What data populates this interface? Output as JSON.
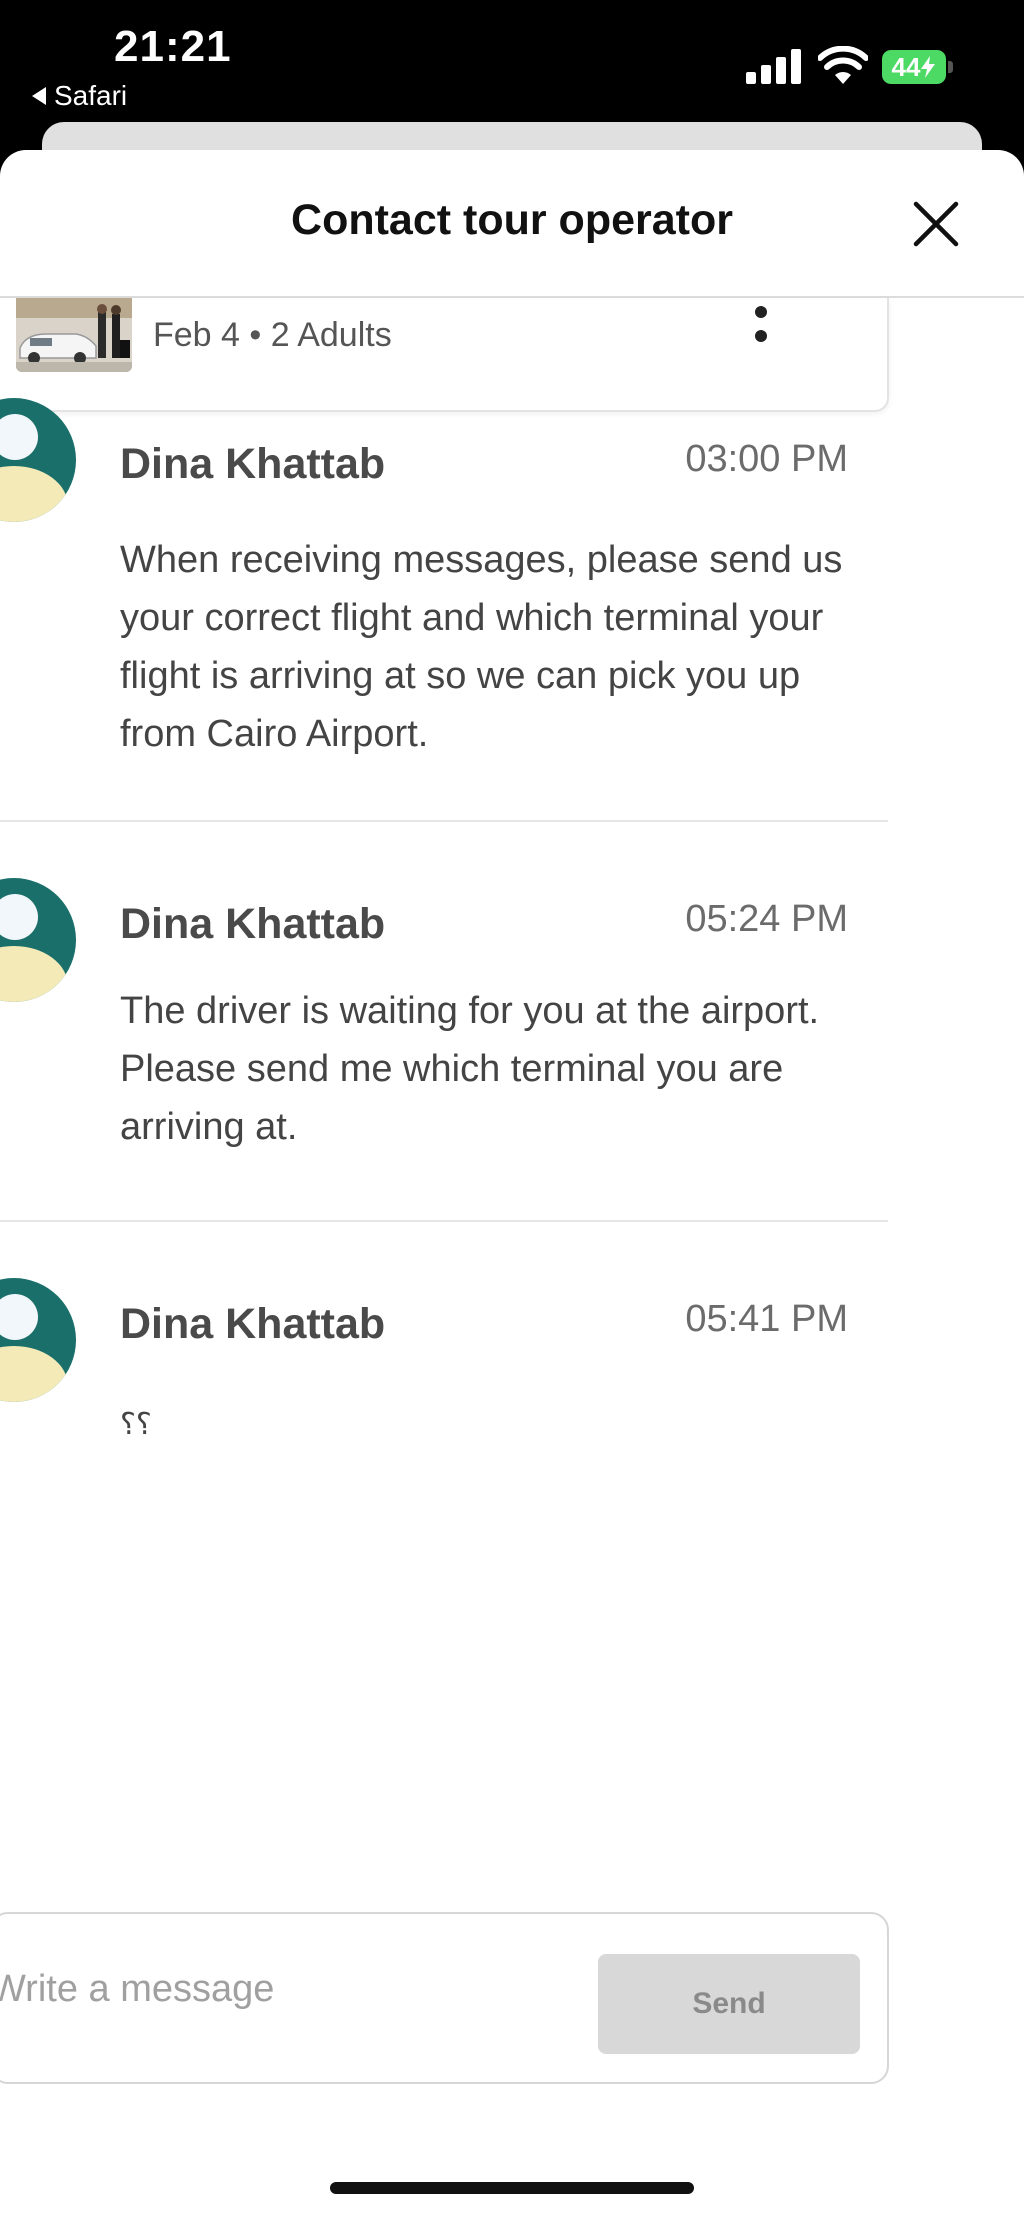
{
  "status_bar": {
    "time": "21:21",
    "back_app": "Safari",
    "battery": "44"
  },
  "sheet": {
    "title": "Contact tour operator"
  },
  "booking": {
    "summary": "Feb 4 • 2 Adults"
  },
  "messages": [
    {
      "sender": "Dina Khattab",
      "time": "03:00 PM",
      "body": "When receiving messages, please send us your correct flight and which terminal your flight is arriving at so we can pick you up from Cairo Airport."
    },
    {
      "sender": "Dina Khattab",
      "time": "05:24 PM",
      "body": "The driver is waiting for you at the airport. Please send me which terminal you are arriving at."
    },
    {
      "sender": "Dina Khattab",
      "time": "05:41 PM",
      "body": "؟؟"
    }
  ],
  "composer": {
    "placeholder": "Write a message",
    "value": "",
    "send_label": "Send"
  },
  "colors": {
    "avatar_bg": "#1a6f6a",
    "avatar_head": "#f2f7fb",
    "avatar_body": "#f3eab8",
    "battery": "#4cd964",
    "send_disabled": "#d8d8d8"
  }
}
